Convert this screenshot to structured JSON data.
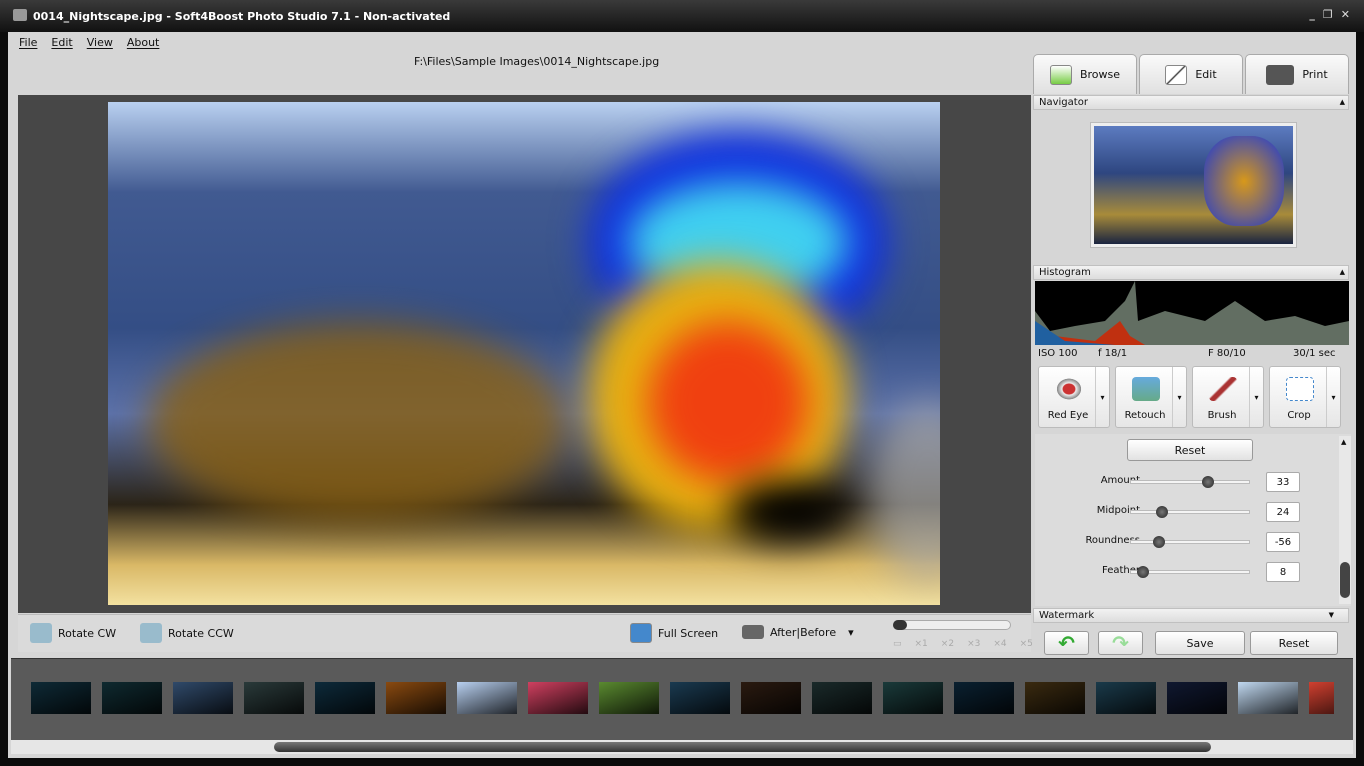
{
  "window": {
    "title": "0014_Nightscape.jpg  -  Soft4Boost Photo Studio 7.1 - Non-activated",
    "controls": [
      "_",
      "❐",
      "✕"
    ]
  },
  "menu": [
    "File",
    "Edit",
    "View",
    "About"
  ],
  "file_path": "F:\\Files\\Sample Images\\0014_Nightscape.jpg",
  "tabs": [
    {
      "label": "Browse",
      "icon": "browse-icon"
    },
    {
      "label": "Edit",
      "icon": "pen-icon"
    },
    {
      "label": "Print",
      "icon": "printer-icon"
    }
  ],
  "panels": {
    "navigator": "Navigator",
    "histogram": "Histogram",
    "watermark": "Watermark"
  },
  "exif": [
    "ISO 100",
    "f 18/1",
    "F 80/10",
    "30/1 sec"
  ],
  "tools": [
    {
      "label": "Red Eye",
      "color": "#c33"
    },
    {
      "label": "Retouch",
      "color": "#6a8"
    },
    {
      "label": "Brush",
      "color": "#a33"
    },
    {
      "label": "Crop",
      "color": "#79c"
    }
  ],
  "settings": {
    "reset": "Reset",
    "sliders": [
      {
        "label": "Amount",
        "value": "33",
        "level": 0.65
      },
      {
        "label": "Midpoint",
        "value": "24",
        "level": 0.26
      },
      {
        "label": "Roundness",
        "value": "-56",
        "level": 0.24
      },
      {
        "label": "Feather",
        "value": "8",
        "level": 0.1
      }
    ]
  },
  "actions": {
    "undo": "↶",
    "redo": "↷",
    "save": "Save",
    "reset": "Reset"
  },
  "toolbar": {
    "rotate_cw": "Rotate CW",
    "rotate_ccw": "Rotate CCW",
    "full_screen": "Full Screen",
    "after_before": "After|Before",
    "dropdown": "▾"
  },
  "zoom": {
    "labels": [
      "▭",
      "×1",
      "×2",
      "×3",
      "×4",
      "×5"
    ],
    "level": 0
  },
  "filmstrip": [
    "#0e2a36",
    "#0f2a30",
    "#304a6a",
    "#2a3a3a",
    "#0d2a3a",
    "#8a4a10",
    "#b8d0f0",
    "#d04060",
    "#5a8a30",
    "#1a3a50",
    "#2a1a10",
    "#1a2a2a",
    "#1a3a3a",
    "#0a2030",
    "#3a2a10",
    "#1a3a4a",
    "#101830",
    "#c0d8f0",
    "#d04030"
  ]
}
